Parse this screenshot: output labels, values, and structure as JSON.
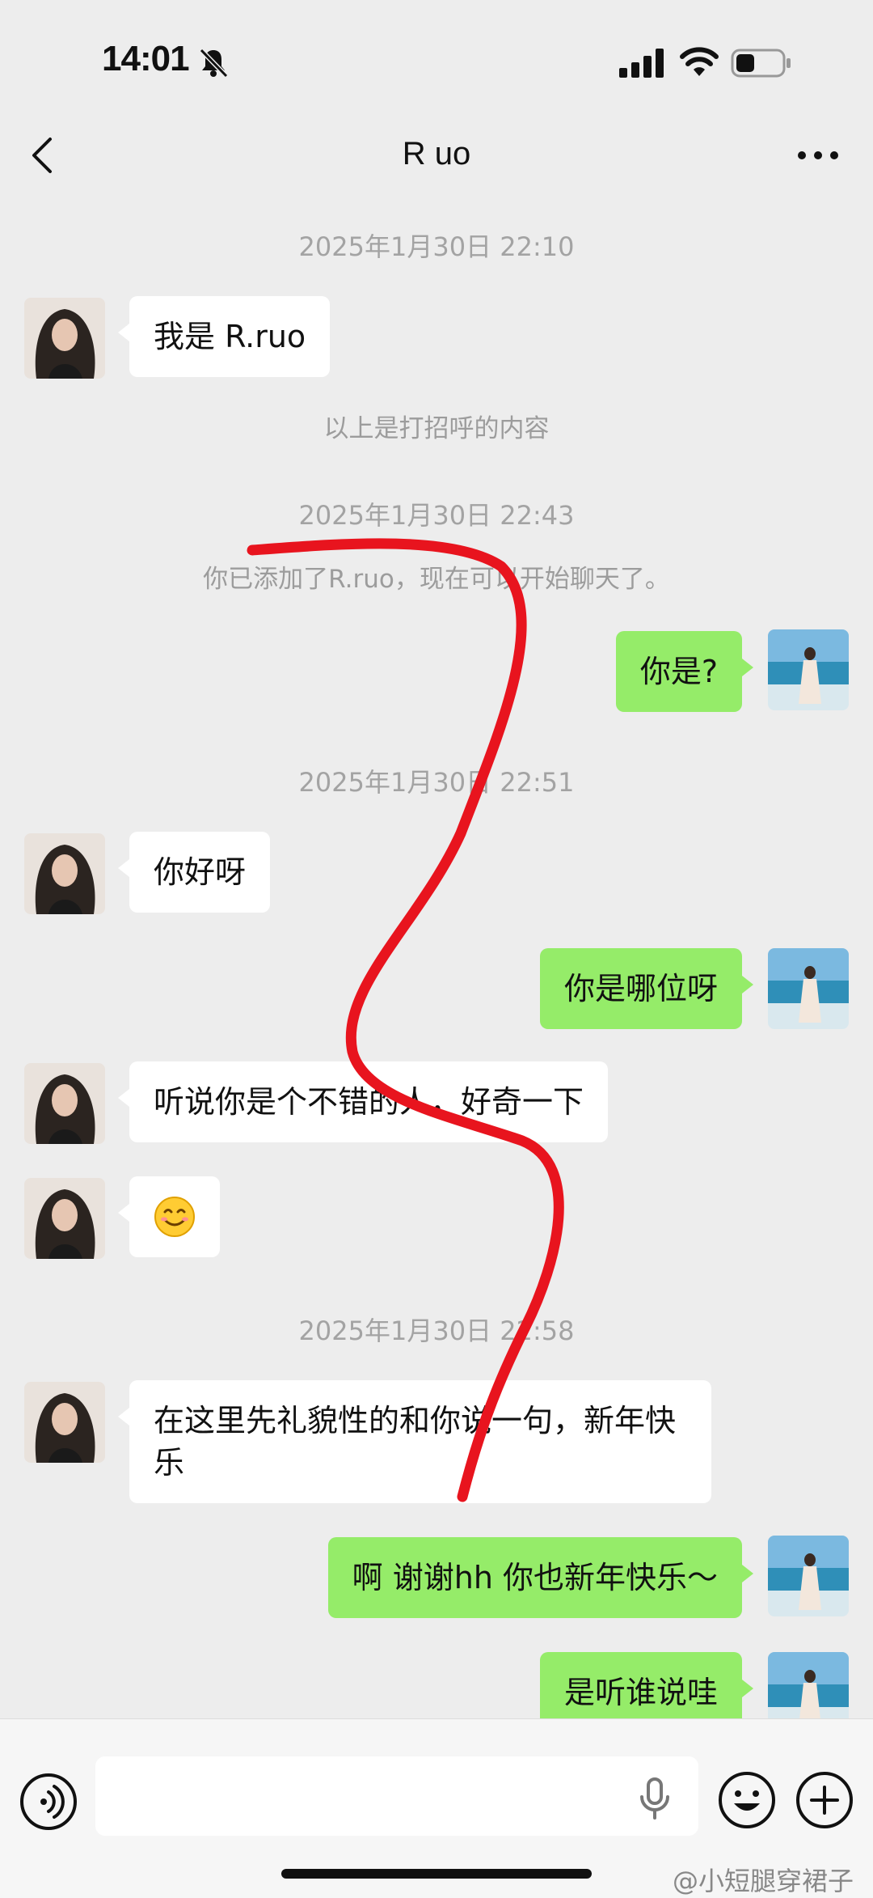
{
  "status_bar": {
    "time": "14:01"
  },
  "nav": {
    "title": "R uo"
  },
  "messages": [
    {
      "kind": "timestamp",
      "text": "2025年1月30日 22:10"
    },
    {
      "kind": "in",
      "text": "我是 R.ruo"
    },
    {
      "kind": "system",
      "text": "以上是打招呼的内容"
    },
    {
      "kind": "timestamp",
      "text": "2025年1月30日 22:43"
    },
    {
      "kind": "system",
      "text": "你已添加了R.ruo，现在可以开始聊天了。"
    },
    {
      "kind": "out",
      "text": "你是?"
    },
    {
      "kind": "timestamp",
      "text": "2025年1月30日 22:51"
    },
    {
      "kind": "in",
      "text": "你好呀"
    },
    {
      "kind": "out",
      "text": "你是哪位呀"
    },
    {
      "kind": "in",
      "text": "听说你是个不错的人，好奇一下"
    },
    {
      "kind": "in",
      "emoji": "smiling-face"
    },
    {
      "kind": "timestamp",
      "text": "2025年1月30日 22:58"
    },
    {
      "kind": "in",
      "text": "在这里先礼貌性的和你说一句，新年快乐"
    },
    {
      "kind": "out",
      "text": "啊 谢谢hh 你也新年快乐～"
    },
    {
      "kind": "out",
      "text": "是听谁说哇"
    }
  ],
  "input": {
    "placeholder": ""
  },
  "watermark": "@小短腿穿裙子",
  "colors": {
    "background": "#ededed",
    "bubble_out": "#95ec69",
    "bubble_in": "#ffffff",
    "annotation_line": "#e8141e"
  }
}
